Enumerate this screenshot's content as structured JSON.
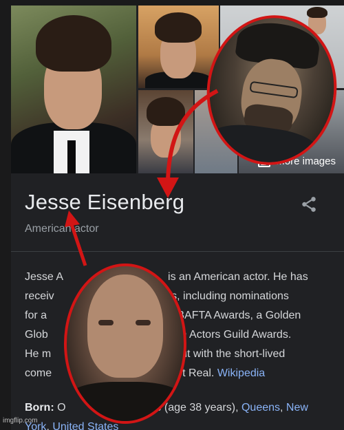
{
  "gallery": {
    "more_images_label": "More images"
  },
  "knowledge_panel": {
    "title": "Jesse Eisenberg",
    "subtitle": "American actor",
    "description_lines": [
      "Jesse A",
      "is an American actor. He has",
      "receiv",
      "les, including nominations",
      "for a",
      "o BAFTA Awards, a Golden",
      "Glob",
      "een Actors Guild Awards.",
      "He m",
      "out with the short-lived",
      "come",
      "t Real.",
      "Wikipedia"
    ],
    "born": {
      "label": "Born:",
      "value_start": "O",
      "value_end": "3 (age 38 years),",
      "place_1": "Queens",
      "place_sep": ",",
      "place_2": "New",
      "place_3": "York",
      "place_4": "United States"
    }
  },
  "watermark": "imgflip.com",
  "colors": {
    "background": "#202124",
    "title": "#e8eaed",
    "link": "#8ab4f8",
    "overlay_red": "#d21515"
  }
}
